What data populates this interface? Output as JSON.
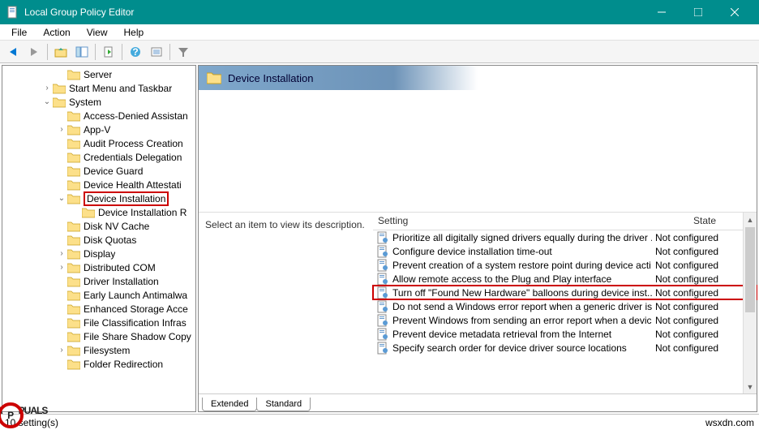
{
  "window": {
    "title": "Local Group Policy Editor"
  },
  "menus": [
    "File",
    "Action",
    "View",
    "Help"
  ],
  "toolbar_icons": [
    "back-icon",
    "forward-icon",
    "up-icon",
    "show-hide-tree-icon",
    "export-icon",
    "refresh-icon",
    "help-icon",
    "properties-icon",
    "filter-icon"
  ],
  "tree": {
    "items": [
      {
        "label": "Server",
        "indent": 2,
        "exp": ""
      },
      {
        "label": "Start Menu and Taskbar",
        "indent": 1,
        "exp": "›"
      },
      {
        "label": "System",
        "indent": 1,
        "exp": "⌄"
      },
      {
        "label": "Access-Denied Assistan",
        "indent": 2,
        "exp": ""
      },
      {
        "label": "App-V",
        "indent": 2,
        "exp": "›"
      },
      {
        "label": "Audit Process Creation",
        "indent": 2,
        "exp": ""
      },
      {
        "label": "Credentials Delegation",
        "indent": 2,
        "exp": ""
      },
      {
        "label": "Device Guard",
        "indent": 2,
        "exp": ""
      },
      {
        "label": "Device Health Attestati",
        "indent": 2,
        "exp": ""
      },
      {
        "label": "Device Installation",
        "indent": 2,
        "exp": "⌄",
        "selected": true
      },
      {
        "label": "Device Installation R",
        "indent": 3,
        "exp": ""
      },
      {
        "label": "Disk NV Cache",
        "indent": 2,
        "exp": ""
      },
      {
        "label": "Disk Quotas",
        "indent": 2,
        "exp": ""
      },
      {
        "label": "Display",
        "indent": 2,
        "exp": "›"
      },
      {
        "label": "Distributed COM",
        "indent": 2,
        "exp": "›"
      },
      {
        "label": "Driver Installation",
        "indent": 2,
        "exp": ""
      },
      {
        "label": "Early Launch Antimalwa",
        "indent": 2,
        "exp": ""
      },
      {
        "label": "Enhanced Storage Acce",
        "indent": 2,
        "exp": ""
      },
      {
        "label": "File Classification Infras",
        "indent": 2,
        "exp": ""
      },
      {
        "label": "File Share Shadow Copy",
        "indent": 2,
        "exp": ""
      },
      {
        "label": "Filesystem",
        "indent": 2,
        "exp": "›"
      },
      {
        "label": "Folder Redirection",
        "indent": 2,
        "exp": ""
      }
    ]
  },
  "right": {
    "header": "Device Installation",
    "desc": "Select an item to view its description.",
    "columns": {
      "setting": "Setting",
      "state": "State"
    },
    "rows": [
      {
        "text": "Prioritize all digitally signed drivers equally during the driver ...",
        "state": "Not configured"
      },
      {
        "text": "Configure device installation time-out",
        "state": "Not configured"
      },
      {
        "text": "Prevent creation of a system restore point during device acti...",
        "state": "Not configured"
      },
      {
        "text": "Allow remote access to the Plug and Play interface",
        "state": "Not configured"
      },
      {
        "text": "Turn off \"Found New Hardware\" balloons during device inst...",
        "state": "Not configured",
        "hl": true
      },
      {
        "text": "Do not send a Windows error report when a generic driver is...",
        "state": "Not configured"
      },
      {
        "text": "Prevent Windows from sending an error report when a devic...",
        "state": "Not configured"
      },
      {
        "text": "Prevent device metadata retrieval from the Internet",
        "state": "Not configured"
      },
      {
        "text": "Specify search order for device driver source locations",
        "state": "Not configured"
      }
    ]
  },
  "tabs": [
    "Extended",
    "Standard"
  ],
  "status": {
    "left": "10 setting(s)",
    "right": "wsxdn.com"
  },
  "watermark": {
    "a": "A",
    "p": "P",
    "rest": "PUALS"
  }
}
